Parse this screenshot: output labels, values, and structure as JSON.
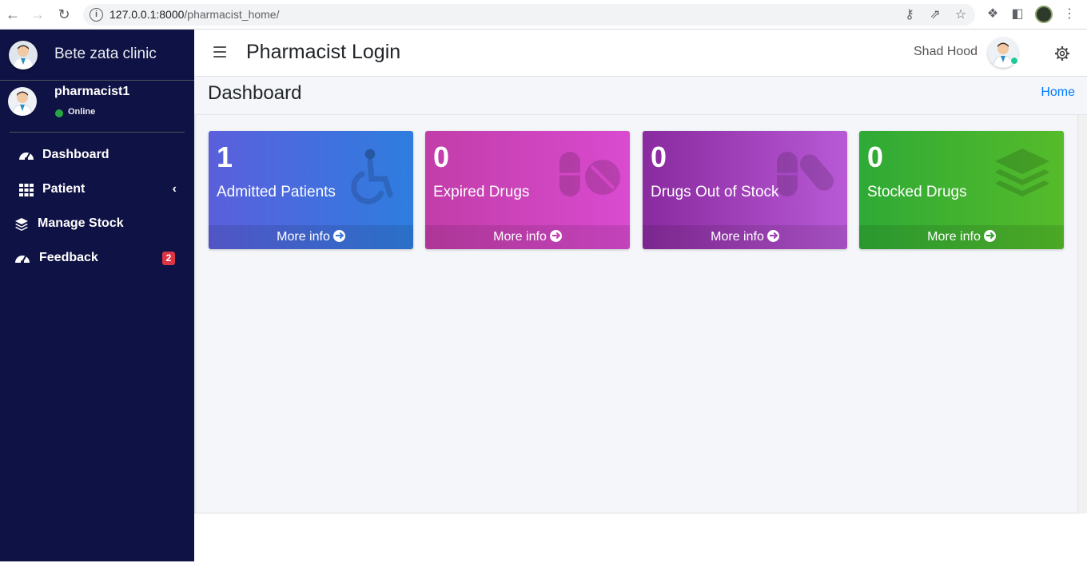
{
  "browser": {
    "url_host": "127.0.0.1:8000",
    "url_path": "/pharmacist_home/"
  },
  "sidebar": {
    "brand": "Bete zata clinic",
    "user": {
      "name": "pharmacist1",
      "status": "Online"
    },
    "items": [
      {
        "label": "Dashboard",
        "icon": "tachometer-icon"
      },
      {
        "label": "Patient",
        "icon": "grid-icon",
        "arrow": "‹"
      },
      {
        "label": "Manage Stock",
        "icon": "layers-icon"
      },
      {
        "label": "Feedback",
        "icon": "tachometer-icon",
        "badge": "2"
      }
    ]
  },
  "topbar": {
    "title": "Pharmacist Login",
    "user_name": "Shad Hood"
  },
  "content": {
    "title": "Dashboard",
    "breadcrumb": "Home"
  },
  "cards": [
    {
      "value": "1",
      "label": "Admitted Patients",
      "footer": "More info",
      "icon": "wheelchair-icon",
      "color": "#3a74dd"
    },
    {
      "value": "0",
      "label": "Expired Drugs",
      "footer": "More info",
      "icon": "pills-icon",
      "color": "#cc42bf"
    },
    {
      "value": "0",
      "label": "Drugs Out of Stock",
      "footer": "More info",
      "icon": "capsules-icon",
      "color": "#a145c0"
    },
    {
      "value": "0",
      "label": "Stocked Drugs",
      "footer": "More info",
      "icon": "layers-icon",
      "color": "#3daf30"
    }
  ]
}
